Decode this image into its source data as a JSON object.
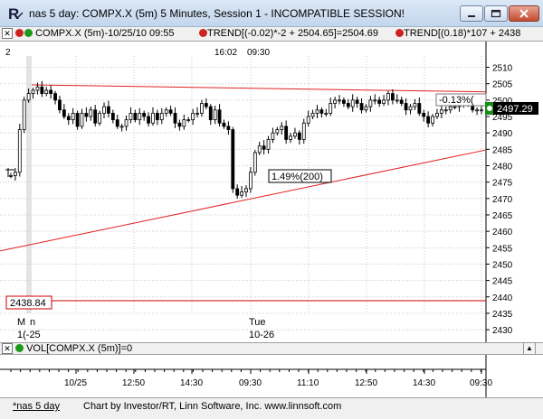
{
  "window": {
    "title": "nas 5 day: COMPX.X (5m) 5 Minutes, Session 1 - INCOMPATIBLE SESSION!"
  },
  "legend": {
    "symbol_label": "COMPX.X (5m)-10/25/10 09:55",
    "trend1_label": "TREND[(-0.02)*-2 + 2504.65]=2504.69",
    "trend2_label": "TREND[(0.18)*107 + 2438"
  },
  "chart": {
    "top_labels": [
      "2",
      "16:02",
      "09:30"
    ],
    "y_ticks": [
      "2510",
      "2505",
      "2500",
      "2495",
      "2490",
      "2485",
      "2480",
      "2475",
      "2470",
      "2465",
      "2460",
      "2455",
      "2450",
      "2445",
      "2440",
      "2435",
      "2430"
    ],
    "price_badge": "2497.29",
    "left_price_label": "2438.84",
    "pct_label_1": "1.49%(200)",
    "pct_label_2": "-0.13%(",
    "day_label_1a": "M",
    "day_label_1b": "n",
    "day_label_1c": "1(-25",
    "day_label_2a": "Tue",
    "day_label_2b": "10-26"
  },
  "volume": {
    "label": "VOL[COMPX.X (5m)]=0"
  },
  "time_axis": [
    "10/25",
    "12:50",
    "14:30",
    "09:30",
    "11:10",
    "12:50",
    "14:30",
    "09:30"
  ],
  "status": {
    "tab": "*nas 5 day",
    "credit": "Chart by Investor/RT, Linn Software, Inc. www.linnsoft.com"
  },
  "chart_data": {
    "type": "candlestick",
    "series": [
      {
        "name": "COMPX.X (5m)"
      }
    ],
    "y_range": [
      2427,
      2514
    ],
    "x_range": [
      0,
      107
    ],
    "last_price": 2497.29,
    "trend1": {
      "slope": -0.02,
      "intercept": 2504.65,
      "value": 2504.69
    },
    "trend2": {
      "slope": 0.18,
      "intercept": 2438
    },
    "horizontal_line": 2438.84,
    "closes": [
      2477,
      2478,
      2491,
      2500,
      2502,
      2503,
      2504,
      2502,
      2503,
      2502,
      2500,
      2497,
      2495,
      2494,
      2496,
      2492,
      2496,
      2495,
      2497,
      2493,
      2496,
      2498,
      2496,
      2494,
      2492,
      2492,
      2494,
      2496,
      2494,
      2496,
      2495,
      2493,
      2496,
      2494,
      2496,
      2497,
      2496,
      2493,
      2492,
      2494,
      2494,
      2496,
      2496,
      2499,
      2498,
      2494,
      2497,
      2493,
      2492,
      2491,
      2473,
      2471,
      2472,
      2473,
      2478,
      2484,
      2486,
      2485,
      2488,
      2490,
      2491,
      2492,
      2488,
      2489,
      2490,
      2488,
      2493,
      2495,
      2496,
      2497,
      2496,
      2496,
      2499,
      2500,
      2500,
      2499,
      2498,
      2500,
      2499,
      2497,
      2498,
      2500,
      2500,
      2499,
      2500,
      2502,
      2500,
      2500,
      2499,
      2497,
      2498,
      2499,
      2496,
      2495,
      2493,
      2495,
      2496,
      2497,
      2497,
      2498,
      2498,
      2500,
      2499,
      2499,
      2497,
      2497,
      2497
    ]
  }
}
